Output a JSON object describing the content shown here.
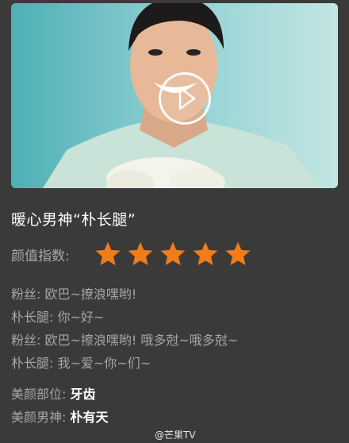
{
  "video": {
    "thumbnail_description": "",
    "play_icon": "play-icon"
  },
  "title": "暖心男神“朴长腿”",
  "rating": {
    "label": "颜值指数:",
    "stars": 5,
    "max": 5,
    "star_color": "#f07d1a"
  },
  "dialogue": [
    "粉丝: 欧巴~撩浪嘿哟!",
    "朴长腿: 你~好~",
    "粉丝: 欧巴~擦浪嘿哟! 哦多尅~哦多尅~",
    "朴长腿: 我~爱~你~们~"
  ],
  "info": [
    {
      "label": "美颜部位:",
      "value": "牙齿"
    },
    {
      "label": "美颜男神:",
      "value": "朴有天"
    }
  ],
  "watermark": "@芒果TV",
  "colors": {
    "background": "#3a3a3a",
    "accent": "#f07d1a"
  }
}
